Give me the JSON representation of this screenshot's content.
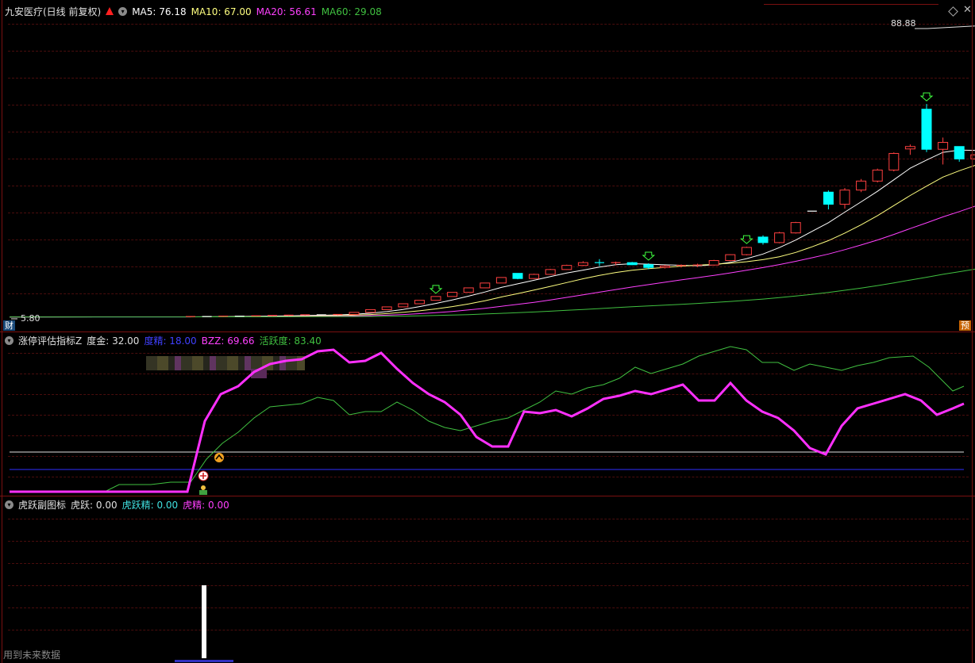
{
  "main": {
    "title": "九安医疗(日线 前复权)",
    "ma5": "MA5: 76.18",
    "ma10": "MA10: 67.00",
    "ma20": "MA20: 56.61",
    "ma60": "MA60: 29.08",
    "high_label": "88.88",
    "low_label": "5.80",
    "corner_left": "财",
    "corner_right": "预",
    "colors": {
      "up": "#ff4040",
      "down": "#00ffff",
      "ma5": "#ffffff",
      "ma10": "#ffff80",
      "ma20": "#ff40ff",
      "ma60": "#40c040"
    }
  },
  "ind1": {
    "name": "涨停评估指标Z",
    "dujin": "度金: 32.00",
    "dujing": "度精: 18.00",
    "bzz": "BZZ: 69.66",
    "huoyuedu": "活跃度: 83.40"
  },
  "ind2": {
    "name": "虎跃副图标",
    "huyue": "虎跃: 0.00",
    "huyuejing": "虎跃精: 0.00",
    "hujing": "虎精: 0.00",
    "footer": "用到未来数据"
  },
  "chart_data": {
    "type": "candlestick",
    "y_range": [
      5.8,
      88.88
    ],
    "candles_ohlc": [
      [
        5.8,
        6.0,
        5.8,
        6.0
      ],
      [
        6.0,
        6.1,
        5.9,
        6.0
      ],
      [
        6.0,
        6.2,
        5.9,
        6.1
      ],
      [
        6.1,
        6.2,
        6.0,
        6.1
      ],
      [
        6.1,
        6.3,
        6.0,
        6.2
      ],
      [
        6.2,
        6.4,
        6.1,
        6.3
      ],
      [
        6.3,
        6.5,
        6.2,
        6.4
      ],
      [
        6.4,
        6.6,
        6.3,
        6.5
      ],
      [
        6.5,
        6.6,
        6.4,
        6.5
      ],
      [
        6.5,
        6.7,
        6.4,
        6.6
      ],
      [
        6.6,
        7.3,
        6.5,
        7.2
      ],
      [
        7.2,
        8.0,
        7.2,
        8.0
      ],
      [
        8.0,
        8.8,
        8.0,
        8.8
      ],
      [
        8.8,
        9.7,
        8.8,
        9.7
      ],
      [
        9.7,
        10.7,
        9.7,
        10.7
      ],
      [
        10.7,
        11.8,
        10.7,
        11.8
      ],
      [
        11.8,
        13.0,
        11.8,
        13.0
      ],
      [
        13.0,
        14.3,
        13.0,
        14.3
      ],
      [
        14.3,
        15.7,
        14.3,
        15.7
      ],
      [
        15.7,
        17.3,
        15.7,
        17.3
      ],
      [
        18.5,
        18.5,
        16.8,
        17.0
      ],
      [
        17.0,
        18.4,
        16.9,
        18.2
      ],
      [
        18.2,
        19.8,
        18.1,
        19.6
      ],
      [
        19.6,
        21.0,
        19.5,
        20.8
      ],
      [
        20.8,
        22.0,
        20.6,
        21.6
      ],
      [
        21.6,
        22.6,
        20.6,
        21.4
      ],
      [
        21.4,
        21.9,
        20.8,
        21.6
      ],
      [
        21.6,
        21.8,
        20.9,
        21.0
      ],
      [
        21.0,
        21.4,
        19.7,
        20.2
      ],
      [
        20.2,
        20.9,
        19.9,
        20.6
      ],
      [
        20.6,
        21.1,
        20.2,
        20.8
      ],
      [
        20.8,
        21.3,
        20.3,
        20.9
      ],
      [
        20.9,
        22.4,
        20.7,
        22.2
      ],
      [
        22.2,
        24.0,
        22.0,
        23.9
      ],
      [
        23.9,
        26.2,
        23.7,
        26.0
      ],
      [
        29.0,
        29.5,
        26.8,
        27.4
      ],
      [
        27.4,
        30.5,
        27.2,
        30.2
      ],
      [
        30.2,
        33.4,
        30.0,
        33.2
      ],
      [
        36.5,
        36.5,
        36.5,
        36.5
      ],
      [
        42.0,
        42.5,
        37.0,
        38.5
      ],
      [
        38.5,
        43.2,
        37.2,
        42.6
      ],
      [
        42.6,
        45.8,
        42.0,
        45.2
      ],
      [
        45.2,
        48.8,
        44.8,
        48.4
      ],
      [
        48.4,
        53.5,
        48.0,
        53.2
      ],
      [
        54.5,
        55.8,
        52.8,
        55.2
      ],
      [
        66.0,
        67.5,
        53.6,
        54.4
      ],
      [
        54.4,
        57.8,
        50.0,
        56.4
      ],
      [
        55.2,
        55.2,
        50.8,
        51.6
      ],
      [
        51.6,
        53.3,
        50.2,
        52.8
      ],
      [
        52.8,
        55.6,
        52.2,
        55.0
      ],
      [
        55.4,
        56.5,
        54.0,
        55.4
      ],
      [
        56.2,
        60.8,
        56.0,
        60.2
      ],
      [
        63.0,
        66.5,
        62.8,
        65.8
      ],
      [
        71.0,
        71.0,
        71.0,
        71.0
      ],
      [
        76.8,
        76.8,
        76.8,
        76.8
      ],
      [
        83.5,
        83.5,
        83.5,
        83.5
      ],
      [
        86.0,
        88.88,
        71.5,
        73.0
      ],
      [
        70.8,
        74.2,
        66.0,
        73.4
      ],
      [
        76.5,
        81.3,
        73.3,
        79.5
      ]
    ],
    "ind1_line1": [
      2,
      2,
      2,
      2,
      2,
      2,
      2,
      2,
      2,
      2,
      2,
      2,
      2,
      2,
      2,
      2,
      2,
      2,
      2,
      2,
      2,
      2,
      2,
      2,
      2,
      2,
      2,
      2,
      2,
      2,
      2,
      2,
      2,
      2,
      2,
      2,
      2,
      2,
      2,
      2,
      2,
      2,
      2,
      2,
      2,
      2,
      2,
      2,
      2,
      2,
      2,
      2,
      2,
      2,
      2,
      2,
      2,
      2,
      2
    ],
    "ind2_bar_value": 1
  }
}
